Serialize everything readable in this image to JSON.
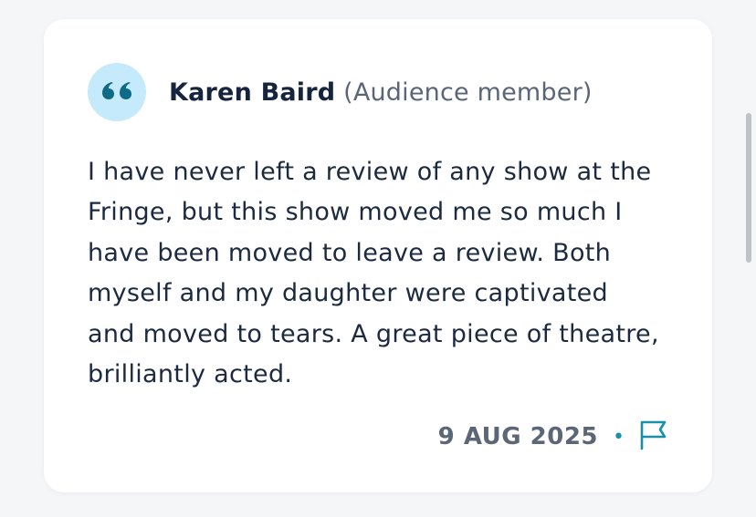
{
  "review": {
    "quote_icon": "quote-icon",
    "author_name": "Karen Baird",
    "author_role": "(Audience member)",
    "text": "I have never left a review of any show at the Fringe, but this show moved me so much I have been moved to leave a review.  Both myself and my daughter were captivated and moved to tears.  A great piece of theatre, brilliantly acted.",
    "date": "9 AUG 2025",
    "separator": "•",
    "flag_icon": "flag-icon"
  },
  "colors": {
    "badge_background": "#c5eafb",
    "accent": "#1a8fa8",
    "text_dark": "#16243d",
    "text_muted": "#5a6678"
  }
}
